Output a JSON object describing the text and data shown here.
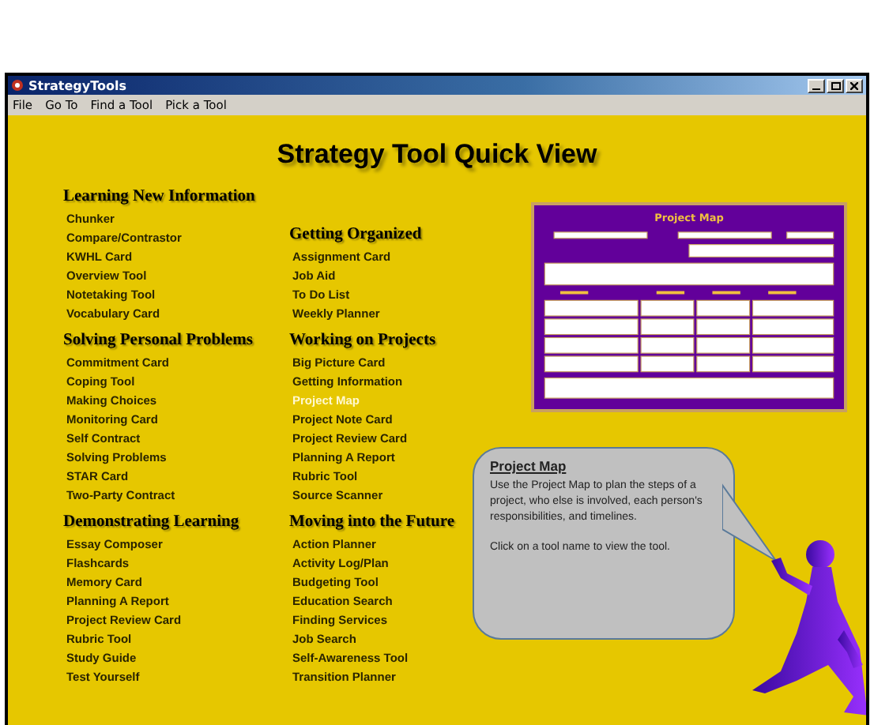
{
  "window": {
    "title": "StrategyTools"
  },
  "menu": [
    "File",
    "Go To",
    "Find a Tool",
    "Pick a Tool"
  ],
  "heading": "Strategy Tool Quick View",
  "columns": [
    {
      "groups": [
        {
          "title": "Learning New Information",
          "items": [
            {
              "label": "Chunker",
              "selected": false
            },
            {
              "label": "Compare/Contrastor",
              "selected": false
            },
            {
              "label": "KWHL Card",
              "selected": false
            },
            {
              "label": "Overview Tool",
              "selected": false
            },
            {
              "label": "Notetaking Tool",
              "selected": false
            },
            {
              "label": "Vocabulary Card",
              "selected": false
            }
          ]
        },
        {
          "title": "Solving Personal Problems",
          "items": [
            {
              "label": "Commitment Card",
              "selected": false
            },
            {
              "label": "Coping Tool",
              "selected": false
            },
            {
              "label": "Making Choices",
              "selected": false
            },
            {
              "label": "Monitoring Card",
              "selected": false
            },
            {
              "label": "Self Contract",
              "selected": false
            },
            {
              "label": "Solving Problems",
              "selected": false
            },
            {
              "label": "STAR Card",
              "selected": false
            },
            {
              "label": "Two-Party Contract",
              "selected": false
            }
          ]
        },
        {
          "title": "Demonstrating Learning",
          "items": [
            {
              "label": "Essay Composer",
              "selected": false
            },
            {
              "label": "Flashcards",
              "selected": false
            },
            {
              "label": "Memory Card",
              "selected": false
            },
            {
              "label": "Planning A Report",
              "selected": false
            },
            {
              "label": "Project Review Card",
              "selected": false
            },
            {
              "label": "Rubric Tool",
              "selected": false
            },
            {
              "label": "Study Guide",
              "selected": false
            },
            {
              "label": "Test Yourself",
              "selected": false
            }
          ]
        }
      ]
    },
    {
      "groups": [
        {
          "title": "Getting Organized",
          "items": [
            {
              "label": "Assignment Card",
              "selected": false
            },
            {
              "label": "Job Aid",
              "selected": false
            },
            {
              "label": "To Do List",
              "selected": false
            },
            {
              "label": "Weekly Planner",
              "selected": false
            }
          ]
        },
        {
          "title": "Working on Projects",
          "items": [
            {
              "label": "Big Picture Card",
              "selected": false
            },
            {
              "label": "Getting Information",
              "selected": false
            },
            {
              "label": "Project Map",
              "selected": true
            },
            {
              "label": "Project Note Card",
              "selected": false
            },
            {
              "label": "Project Review Card",
              "selected": false
            },
            {
              "label": "Planning A Report",
              "selected": false
            },
            {
              "label": "Rubric Tool",
              "selected": false
            },
            {
              "label": "Source Scanner",
              "selected": false
            }
          ]
        },
        {
          "title": "Moving into the Future",
          "items": [
            {
              "label": "Action Planner",
              "selected": false
            },
            {
              "label": "Activity Log/Plan",
              "selected": false
            },
            {
              "label": "Budgeting Tool",
              "selected": false
            },
            {
              "label": "Education Search",
              "selected": false
            },
            {
              "label": "Finding Services",
              "selected": false
            },
            {
              "label": "Job Search",
              "selected": false
            },
            {
              "label": "Self-Awareness Tool",
              "selected": false
            },
            {
              "label": "Transition Planner",
              "selected": false
            }
          ]
        }
      ]
    }
  ],
  "preview": {
    "title": "Project Map"
  },
  "bubble": {
    "title": "Project Map",
    "paragraphs": [
      "Use the Project Map to plan the steps of a project, who else is involved, each person's responsibilities, and timelines.",
      "Click on a tool name to view the tool."
    ]
  }
}
